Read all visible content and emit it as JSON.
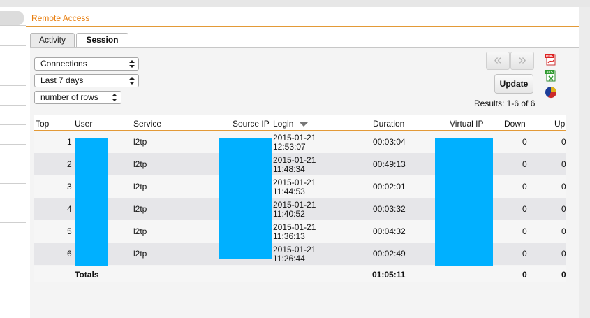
{
  "breadcrumb": "Remote Access",
  "tabs": [
    {
      "label": "Activity",
      "active": false
    },
    {
      "label": "Session",
      "active": true
    }
  ],
  "filters": {
    "report": "Connections",
    "period": "Last 7 days",
    "rows": "number of rows"
  },
  "pager": {
    "prev": "«",
    "next": "»"
  },
  "update_label": "Update",
  "results_text": "Results: 1-6 of 6",
  "exports": [
    {
      "name": "pdf-export-icon",
      "label": "PDF"
    },
    {
      "name": "xls-export-icon",
      "label": "XLS"
    },
    {
      "name": "chart-export-icon",
      "label": ""
    }
  ],
  "table": {
    "columns": [
      "Top",
      "User",
      "Service",
      "Source IP",
      "Login",
      "Duration",
      "Virtual IP",
      "Down",
      "Up"
    ],
    "sort_column": "Login",
    "rows": [
      {
        "top": "1",
        "service": "l2tp",
        "login_date": "2015-01-21",
        "login_time": "12:53:07",
        "duration": "00:03:04",
        "down": "0",
        "up": "0"
      },
      {
        "top": "2",
        "service": "l2tp",
        "login_date": "2015-01-21",
        "login_time": "11:48:34",
        "duration": "00:49:13",
        "down": "0",
        "up": "0"
      },
      {
        "top": "3",
        "service": "l2tp",
        "login_date": "2015-01-21",
        "login_time": "11:44:53",
        "duration": "00:02:01",
        "down": "0",
        "up": "0"
      },
      {
        "top": "4",
        "service": "l2tp",
        "login_date": "2015-01-21",
        "login_time": "11:40:52",
        "duration": "00:03:32",
        "down": "0",
        "up": "0"
      },
      {
        "top": "5",
        "service": "l2tp",
        "login_date": "2015-01-21",
        "login_time": "11:36:13",
        "duration": "00:04:32",
        "down": "0",
        "up": "0"
      },
      {
        "top": "6",
        "service": "l2tp",
        "login_date": "2015-01-21",
        "login_time": "11:26:44",
        "duration": "00:02:49",
        "down": "0",
        "up": "0"
      }
    ],
    "totals": {
      "label": "Totals",
      "duration": "01:05:11",
      "down": "0",
      "up": "0"
    }
  },
  "colors": {
    "accent": "#e87d0d",
    "redaction": "#00b0ff"
  }
}
